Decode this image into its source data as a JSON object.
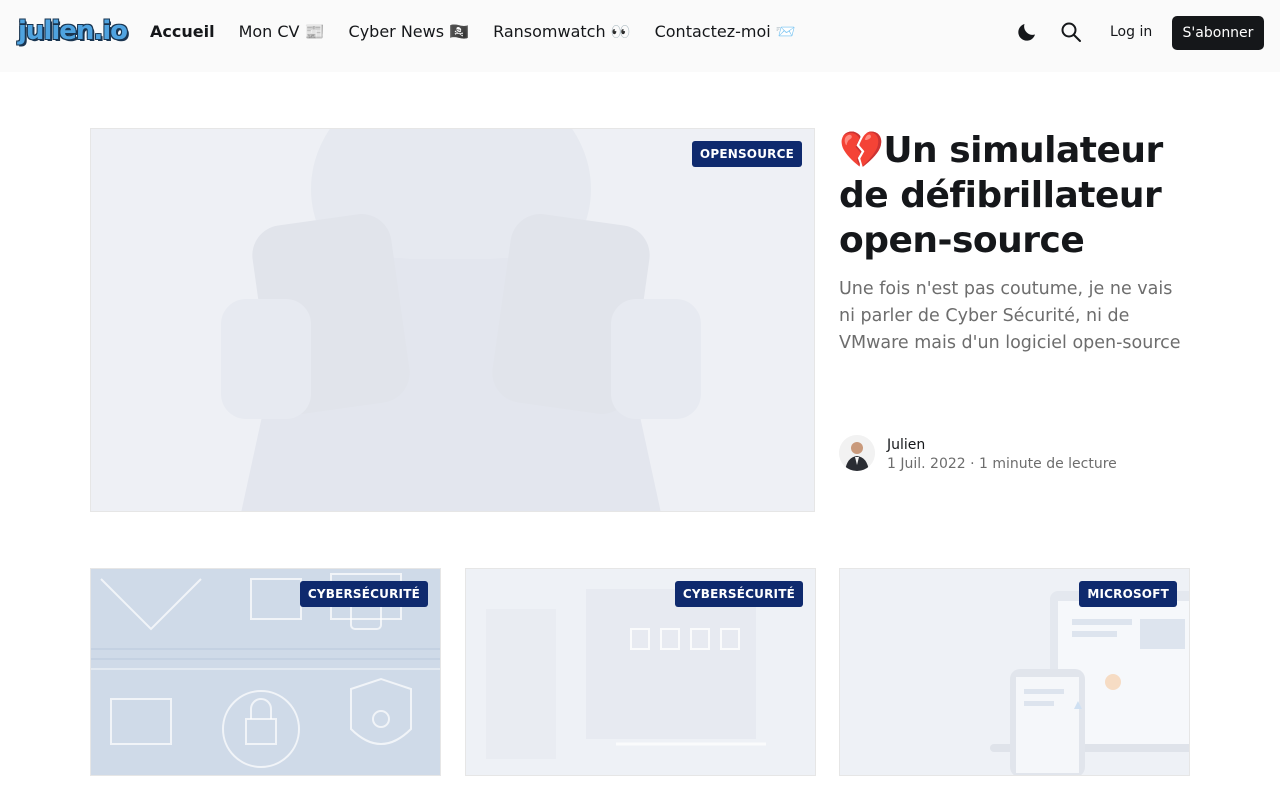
{
  "header": {
    "logo_text": "julien.io",
    "nav": [
      {
        "label": "Accueil",
        "active": true
      },
      {
        "label": "Mon CV 📰",
        "active": false
      },
      {
        "label": "Cyber News 🏴‍☠️",
        "active": false
      },
      {
        "label": "Ransomwatch 👀",
        "active": false
      },
      {
        "label": "Contactez-moi 📨",
        "active": false
      }
    ],
    "dark_mode_icon": "moon-icon",
    "search_icon": "search-icon",
    "login_label": "Log in",
    "subscribe_label": "S'abonner"
  },
  "featured": {
    "tag": "OPENSOURCE",
    "title": "💔Un simulateur de défibrillateur open-source",
    "excerpt": "Une fois n'est pas coutume, je ne vais ni parler de Cyber Sécurité, ni de VMware mais d'un logiciel open-source qui simul…",
    "author": "Julien",
    "date": "1 Juil. 2022",
    "read_time": "1 minute de lecture"
  },
  "cards": [
    {
      "tag": "CYBERSÉCURITÉ"
    },
    {
      "tag": "CYBERSÉCURITÉ"
    },
    {
      "tag": "MICROSOFT"
    }
  ],
  "colors": {
    "tag_bg": "#0f2a6e",
    "button_bg": "#15171a",
    "header_bg": "#fafafa"
  }
}
